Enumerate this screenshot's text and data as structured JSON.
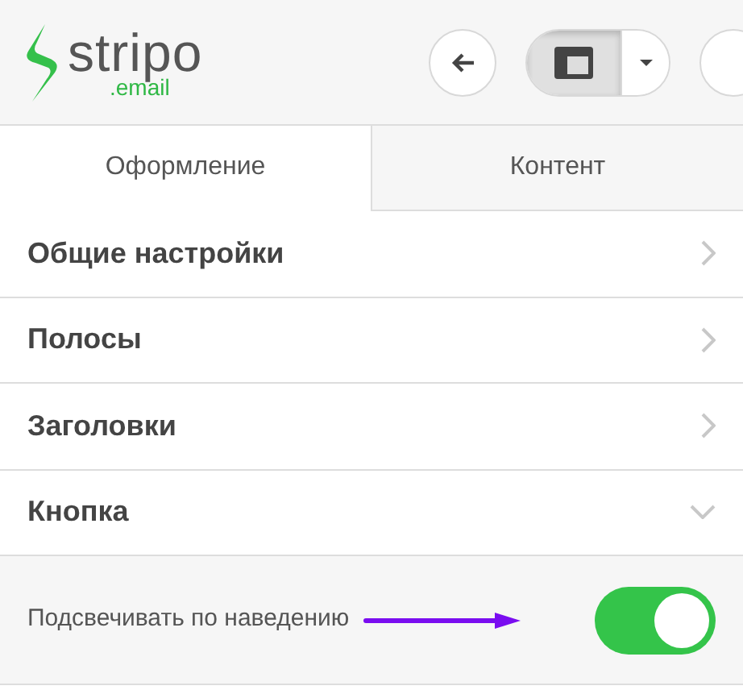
{
  "logo": {
    "name": "stripo",
    "suffix": ".email"
  },
  "tabs": [
    {
      "label": "Оформление",
      "selected": true
    },
    {
      "label": "Контент",
      "selected": false
    }
  ],
  "sections": [
    {
      "label": "Общие настройки",
      "expanded": false
    },
    {
      "label": "Полосы",
      "expanded": false
    },
    {
      "label": "Заголовки",
      "expanded": false
    },
    {
      "label": "Кнопка",
      "expanded": true
    }
  ],
  "setting": {
    "label": "Подсвечивать по наведению",
    "on": true
  }
}
